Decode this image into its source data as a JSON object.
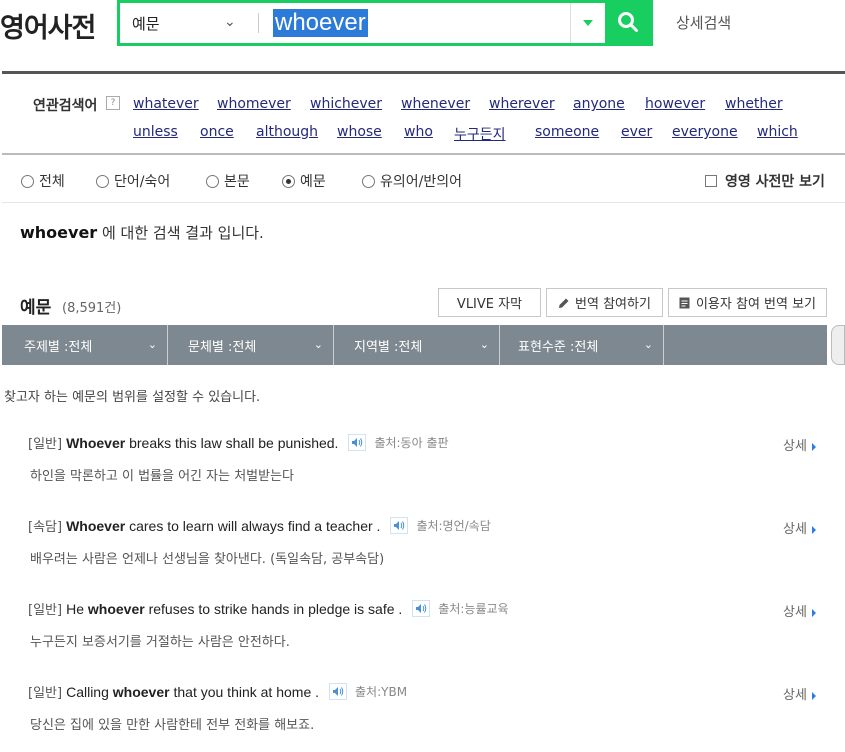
{
  "header": {
    "logo": "영어사전",
    "scope": "예문",
    "query": "whoever",
    "detail_search": "상세검색"
  },
  "related": {
    "label": "연관검색어",
    "help": "?",
    "row1": [
      "whatever",
      "whomever",
      "whichever",
      "whenever",
      "wherever",
      "anyone",
      "however",
      "whether"
    ],
    "row2": [
      "unless",
      "once",
      "although",
      "whose",
      "who",
      "누구든지",
      "someone",
      "ever",
      "everyone",
      "which"
    ]
  },
  "filters": {
    "options": [
      "전체",
      "단어/숙어",
      "본문",
      "예문",
      "유의어/반의어"
    ],
    "selected": "예문",
    "only_en_en": "영영 사전만 보기"
  },
  "result_message": {
    "keyword": "whoever",
    "text": "에 대한 검색 결과 입니다."
  },
  "examples": {
    "title": "예문",
    "count": "(8,591건)",
    "buttons": {
      "vlive": "VLIVE 자막",
      "translate": "번역 참여하기",
      "user_translate": "이용자 참여 번역 보기"
    },
    "filterbar": [
      {
        "label": "주제별",
        "value": ":전체"
      },
      {
        "label": "문체별",
        "value": ":전체"
      },
      {
        "label": "지역별",
        "value": ":전체"
      },
      {
        "label": "표현수준",
        "value": ":전체"
      }
    ],
    "hint": "찾고자 하는 예문의 범위를 설정할 수 있습니다.",
    "more_label": "상세",
    "rows": [
      {
        "tag": "[일반]",
        "pre": "",
        "bold": "Whoever",
        "post": " breaks this law shall be punished.",
        "source": "출처:동아 출판",
        "translation": "하인을 막론하고 이 법률을 어긴 자는 처벌받는다"
      },
      {
        "tag": "[속담]",
        "pre": "",
        "bold": "Whoever",
        "post": " cares to learn will always find a teacher .",
        "source": "출처:명언/속담",
        "translation": "배우려는 사람은 언제나 선생님을 찾아낸다. (독일속담, 공부속담)"
      },
      {
        "tag": "[일반]",
        "pre": "He ",
        "bold": "whoever",
        "post": " refuses to strike hands in pledge is safe .",
        "source": "출처:능률교육",
        "translation": "누구든지 보증서기를 거절하는 사람은 안전하다."
      },
      {
        "tag": "[일반]",
        "pre": "Calling ",
        "bold": "whoever",
        "post": " that you think at home .",
        "source": "출처:YBM",
        "translation": "당신은 집에 있을 만한 사람한테 전부 전화를 해보죠."
      }
    ]
  },
  "colors": {
    "brand_green": "#19ce60",
    "link": "#23297b",
    "filterbar": "#7d8891",
    "selection": "#2d7bd8"
  }
}
